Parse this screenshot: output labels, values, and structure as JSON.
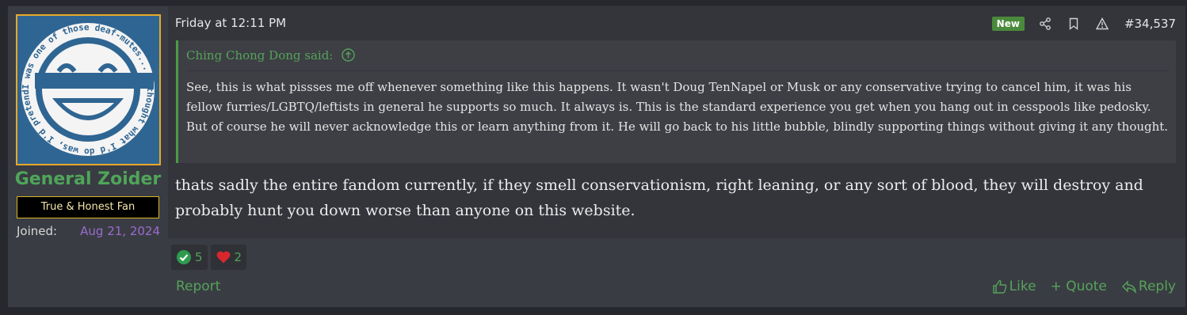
{
  "post": {
    "date": "Friday at 12:11 PM",
    "new_badge": "New",
    "number": "#34,537",
    "message": "thats sadly the entire fandom currently, if they smell conservationism, right leaning, or any sort of blood, they will destroy and probably hunt you down worse than anyone on this website."
  },
  "user": {
    "name": "General Zoider",
    "title": "True & Honest Fan",
    "joined_label": "Joined:",
    "joined_value": "Aug 21, 2024",
    "avatar_text": "I was one of those deaf-mutes... I thought what I'd do was, I'd pretend"
  },
  "quote": {
    "author_line": "Ching Chong Dong said:",
    "body": "See, this is what pissses me off whenever something like this happens. It wasn't Doug TenNapel or Musk or any conservative trying to cancel him, it was his fellow furries/LGBTQ/leftists in general he supports so much. It always is. This is the standard experience you get when you hang out in cesspools like pedosky. But of course he will never acknowledge this or learn anything from it. He will go back to his little bubble, blindly supporting things without giving it any thought."
  },
  "reactions": [
    {
      "icon": "checkmark-icon",
      "count": "5"
    },
    {
      "icon": "heart-icon",
      "count": "2"
    }
  ],
  "footer": {
    "report": "Report",
    "like": "Like",
    "quote": "+ Quote",
    "reply": "Reply"
  },
  "colors": {
    "accent_green": "#55a35a",
    "username_green": "#4fa55a",
    "joined_date_purple": "#9a6ccf",
    "badge_gold": "#d8b62a"
  }
}
